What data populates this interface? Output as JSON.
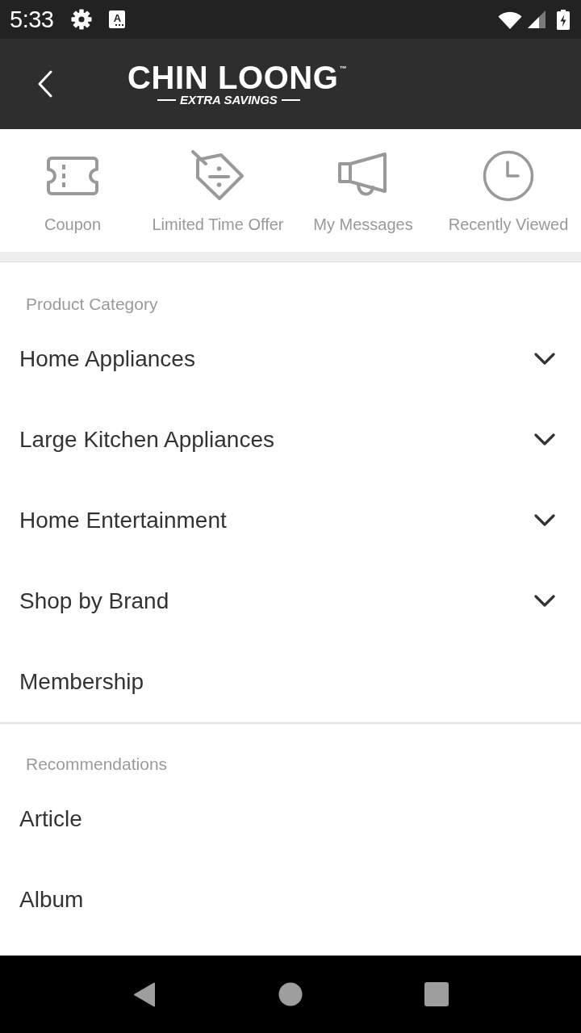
{
  "status_bar": {
    "time": "5:33",
    "notification_letter": "A"
  },
  "header": {
    "logo": {
      "wordmark": "CHIN LOONG",
      "trademark": "™",
      "tagline": "EXTRA SAVINGS"
    }
  },
  "shortcuts": [
    {
      "label": "Coupon"
    },
    {
      "label": "Limited Time Offer"
    },
    {
      "label": "My Messages"
    },
    {
      "label": "Recently Viewed"
    }
  ],
  "sections": [
    {
      "title": "Product Category",
      "items": [
        {
          "label": "Home Appliances",
          "kind": "expandable"
        },
        {
          "label": "Large Kitchen Appliances",
          "kind": "expandable"
        },
        {
          "label": "Home Entertainment",
          "kind": "expandable"
        },
        {
          "label": "Shop by Brand",
          "kind": "expandable"
        },
        {
          "label": "Membership",
          "kind": "link"
        }
      ]
    },
    {
      "title": "Recommendations",
      "items": [
        {
          "label": "Article",
          "kind": "link"
        },
        {
          "label": "Album",
          "kind": "link"
        }
      ]
    }
  ]
}
